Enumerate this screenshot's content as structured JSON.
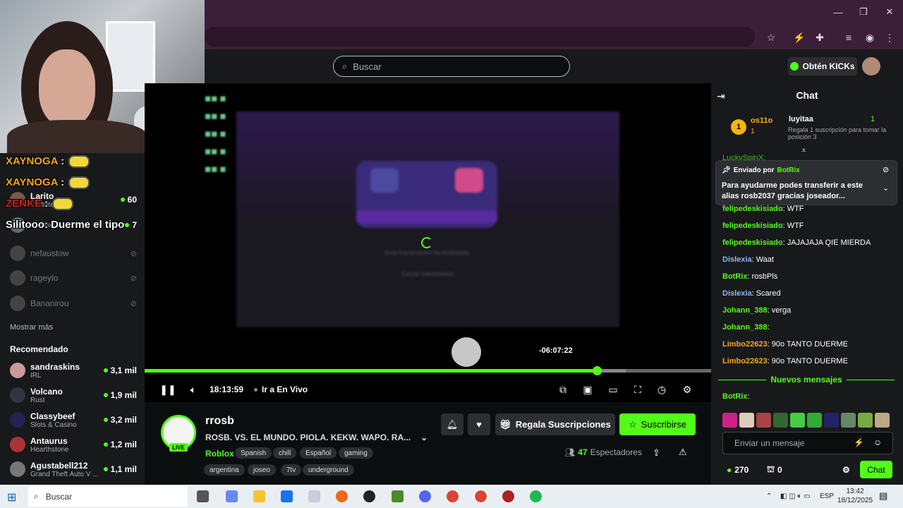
{
  "window": {
    "minimize": "—",
    "restore": "❐",
    "close": "✕"
  },
  "header": {
    "search_placeholder": "Buscar",
    "kicks_label": "Obtén KICKs"
  },
  "overlay_chat": [
    {
      "user": "XAYNOGA",
      "text": ":"
    },
    {
      "user": "XAYNOGA",
      "text": ":"
    },
    {
      "user": "ZENKE",
      "text": ":"
    },
    {
      "user": "Silitooo",
      "text": ": Duerme el tipo"
    }
  ],
  "sidebar": {
    "following": [
      {
        "name": "Larito",
        "category": "Fortnite",
        "viewers": "60"
      },
      {
        "name": "",
        "category": "Roblox",
        "viewers": "7"
      },
      {
        "name": "nefaustow"
      },
      {
        "name": "rageylo"
      },
      {
        "name": "Bananirou"
      }
    ],
    "show_more": "Mostrar más",
    "recommended_title": "Recomendado",
    "recommended": [
      {
        "name": "sandraskins",
        "category": "IRL",
        "viewers": "3,1 mil"
      },
      {
        "name": "Volcano",
        "category": "Rust",
        "viewers": "1,9 mil"
      },
      {
        "name": "Classybeef",
        "category": "Slots & Casino",
        "viewers": "3,2 mil"
      },
      {
        "name": "Antaurus",
        "category": "Hearthstone",
        "viewers": "1,2 mil"
      },
      {
        "name": "Agustabell212",
        "category": "Grand Theft Auto V ...",
        "viewers": "1,1 mil"
      }
    ]
  },
  "player": {
    "ended_text": "Esta transmisión ha finalizado.",
    "close_text": "Cerrar transmisión",
    "tooltip_time": "-06:07:22",
    "elapsed": "18:13:59",
    "go_live": "Ir a En Vivo",
    "progress": 0.8
  },
  "stream": {
    "channel": "rrosb",
    "live_badge": "LIVE",
    "title": "ROSB. VS. EL MUNDO. PIOLA. KEKW. WAPO. RA...",
    "category": "Roblox",
    "tags": [
      "Spanish",
      "chill",
      "Español",
      "gaming",
      "argentina",
      "joseo",
      "7tv",
      "underground"
    ],
    "gift_label": "Regala Suscripciones",
    "subscribe_label": "Suscribirse",
    "viewers_count": "47",
    "viewers_label": "Espectadores"
  },
  "chat": {
    "title": "Chat",
    "top_gifter": {
      "rank": "1",
      "name": "os11o",
      "count": "1",
      "name2": "luyitaa",
      "count2": "1",
      "promo": "Regala 1 suscripción para tomar la posición 3"
    },
    "partial_msg": "LuckySpinX:",
    "pinned": {
      "sent_by": "Enviado por",
      "author": "BotRix",
      "text": "Para ayudarme podes transferir a este alias rosb2037 gracias joseador..."
    },
    "messages": [
      {
        "user": "felipedeskisiado",
        "text": ": WTF",
        "color": "#53fc18"
      },
      {
        "user": "felipedeskisiado",
        "text": ": WTF",
        "color": "#53fc18"
      },
      {
        "user": "felipedeskisiado",
        "text": ": JAJAJAJA QIE MIERDA",
        "color": "#53fc18"
      },
      {
        "user": "Dislexia",
        "text": ": Waat",
        "color": "#8ab4f8"
      },
      {
        "user": "BotRix",
        "text": ": rosbPls",
        "color": "#53fc18"
      },
      {
        "user": "Dislexia",
        "text": ": Scared",
        "color": "#8ab4f8"
      },
      {
        "user": "Johann_388",
        "text": ": verga",
        "color": "#53fc18"
      },
      {
        "user": "Johann_388",
        "text": ":",
        "color": "#53fc18"
      },
      {
        "user": "Limbo22623",
        "text": ": 90o TANTO DUERME",
        "color": "#f6a623"
      },
      {
        "user": "Limbo22623",
        "text": ": 90o TANTO DUERME",
        "color": "#f6a623"
      }
    ],
    "new_messages": "Nuevos mensajes",
    "after_new": {
      "user": "BotRix",
      "text": ":"
    },
    "input_placeholder": "Enviar un mensaje",
    "points": "270",
    "secondary_count": "0",
    "send_label": "Chat"
  },
  "taskbar": {
    "search_label": "Buscar",
    "lang": "ESP",
    "time": "13:42",
    "date": "18/12/2025"
  },
  "colors": {
    "accent": "#53fc18",
    "bg": "#0b0e0f",
    "panel": "#18191b",
    "titlebar": "#3b1f38"
  }
}
